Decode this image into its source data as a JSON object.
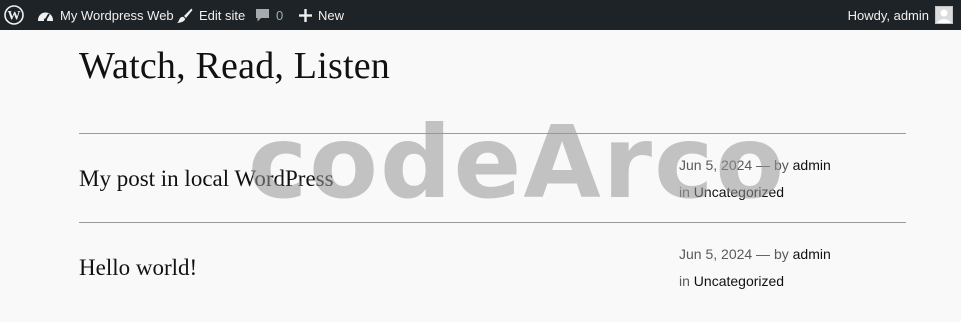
{
  "adminbar": {
    "site_name": "My Wordpress Web",
    "edit_label": "Edit site",
    "comments_count": "0",
    "new_label": "New",
    "greeting": "Howdy, admin"
  },
  "site": {
    "title": "Watch, Read, Listen"
  },
  "posts": [
    {
      "title": "My post in local WordPress",
      "date": "Jun 5, 2024",
      "by_text": " — by ",
      "author": "admin",
      "in_text": "in ",
      "category": "Uncategorized"
    },
    {
      "title": "Hello world!",
      "date": "Jun 5, 2024",
      "by_text": " — by ",
      "author": "admin",
      "in_text": "in ",
      "category": "Uncategorized"
    }
  ],
  "watermark": "codeArco",
  "colors": {
    "adminbar_bg": "#1d2327",
    "page_bg": "#f9f9f9",
    "text": "#111111"
  }
}
